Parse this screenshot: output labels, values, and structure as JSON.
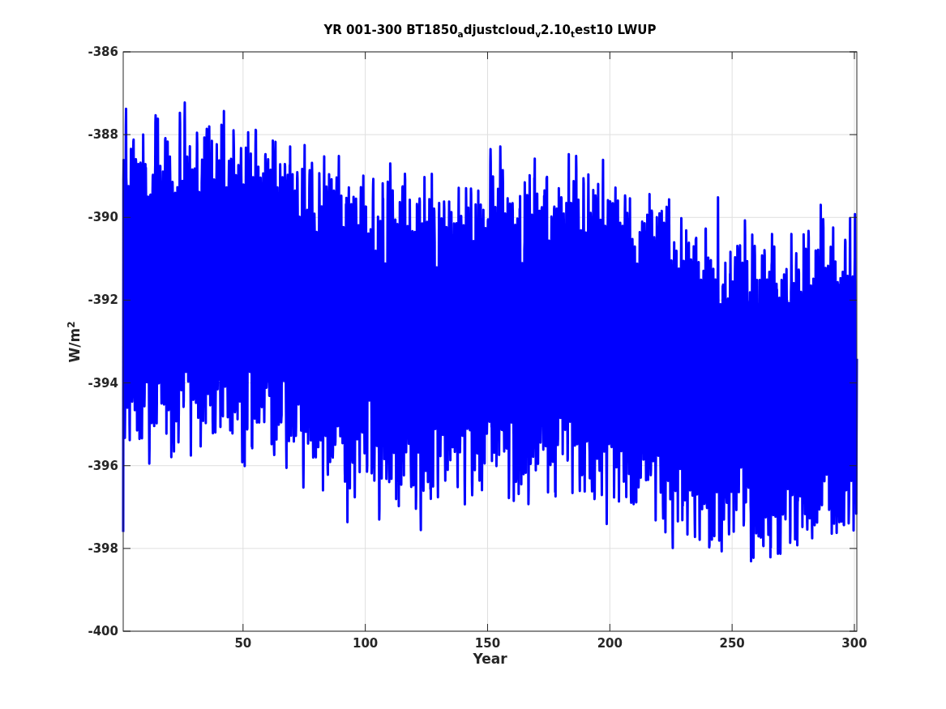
{
  "figure": {
    "title": "YR 001-300 BT1850$_{a}$djustcloud$_{v}$2.10$_{t}$est10 LWUP",
    "xlabel": "Year",
    "ylabel": "W/m$^{2}$",
    "xtick_labels": [
      "50",
      "100",
      "150",
      "200",
      "250",
      "300"
    ],
    "ytick_labels": [
      "-386",
      "-388",
      "-390",
      "-392",
      "-394",
      "-396",
      "-398",
      "-400"
    ]
  }
}
